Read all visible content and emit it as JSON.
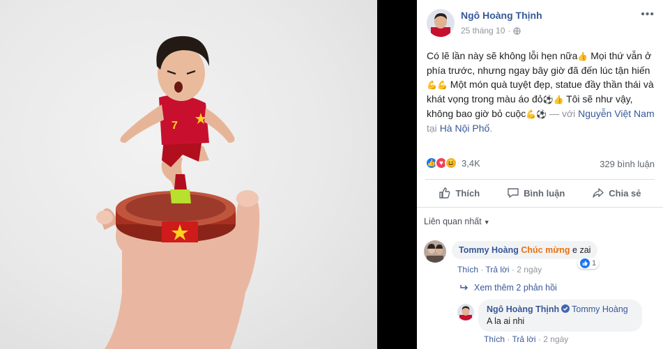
{
  "post": {
    "author": "Ngô Hoàng Thịnh",
    "date": "25 tháng 10",
    "dot": "·",
    "text_part1": "Có lẽ lần này sẽ không lỗi hẹn nữa",
    "text_part2": " Mọi thứ vẫn ở phía trước, nhưng ngay bây giờ đã đến lúc tận hiến",
    "text_part3": " Một món quà tuyệt đẹp, statue đầy thần thái và khát vọng trong màu áo đỏ",
    "text_part4": " Tôi sẽ như vậy, không bao giờ bỏ cuộc",
    "with_label": " — với ",
    "with_person": "Nguyễn Việt Nam",
    "at_label": " tại ",
    "location": "Hà Nội Phố",
    "period": "."
  },
  "stats": {
    "reactions": "3,4K",
    "comments": "329 bình luận"
  },
  "actions": {
    "like": "Thích",
    "comment": "Bình luận",
    "share": "Chia sẻ"
  },
  "sort": {
    "label": "Liên quan nhất"
  },
  "comments": [
    {
      "name": "Tommy Hoàng",
      "tag": "Chúc mừng",
      "text": " e zai",
      "likes": "1",
      "like_action": "Thích",
      "reply_action": "Trả lời",
      "time": "2 ngày"
    }
  ],
  "more_replies": "Xem thêm 2 phản hồi",
  "reply": {
    "name": "Ngô Hoàng Thịnh",
    "mention": "Tommy Hoàng",
    "text": "A la ai nhi",
    "like_action": "Thích",
    "reply_action": "Trả lời",
    "time": "2 ngày"
  },
  "colors": {
    "link": "#365899",
    "like_blue": "#1877f2",
    "love_red": "#f33e58",
    "haha_yellow": "#f7b125",
    "tag_orange": "#e9710f",
    "shirt_red": "#c8102e"
  },
  "icons": [
    "globe-icon",
    "more-options-icon",
    "like-icon",
    "comment-icon",
    "share-icon",
    "verified-icon",
    "reply-arrow-icon"
  ]
}
